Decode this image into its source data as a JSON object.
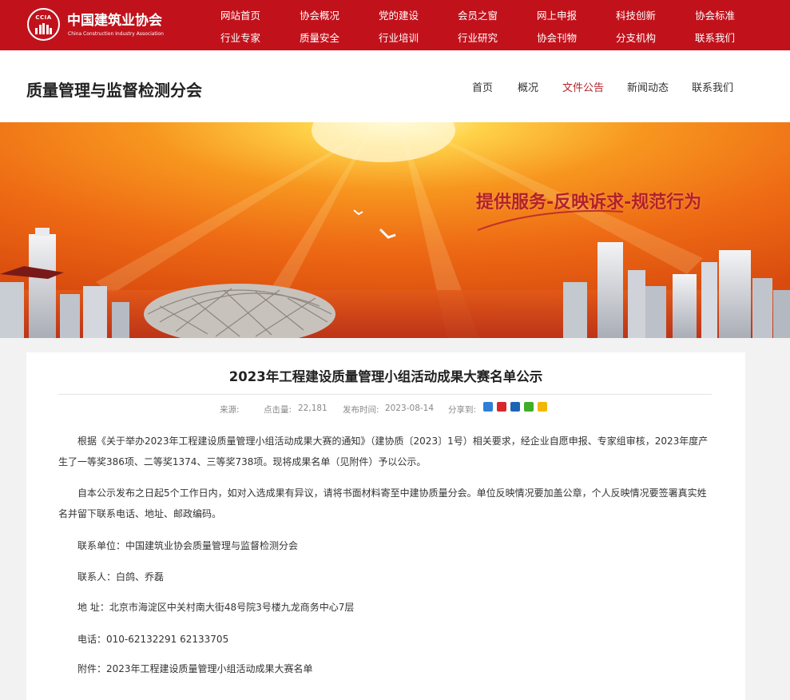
{
  "header": {
    "logo_abbr": "CCIA",
    "logo_cn": "中国建筑业协会",
    "logo_en": "China Construction Industry Association",
    "nav_row1": [
      "网站首页",
      "协会概况",
      "党的建设",
      "会员之窗",
      "网上申报",
      "科技创新",
      "协会标准"
    ],
    "nav_row2": [
      "行业专家",
      "质量安全",
      "行业培训",
      "行业研究",
      "协会刊物",
      "分支机构",
      "联系我们"
    ]
  },
  "subheader": {
    "title": "质量管理与监督检测分会",
    "nav": [
      "首页",
      "概况",
      "文件公告",
      "新闻动态",
      "联系我们"
    ],
    "active_index": 2
  },
  "banner": {
    "slogan": "提供服务-反映诉求-规范行为"
  },
  "article": {
    "title": "2023年工程建设质量管理小组活动成果大赛名单公示",
    "meta": {
      "source_label": "来源:",
      "clicks_label": "点击量:",
      "clicks": "22,181",
      "date_label": "发布时间:",
      "date": "2023-08-14",
      "share_label": "分享到:"
    },
    "share_icons": [
      "plus-share-icon",
      "weibo-share-icon",
      "renren-share-icon",
      "wechat-share-icon",
      "qzone-share-icon"
    ],
    "paragraphs": [
      "根据《关于举办2023年工程建设质量管理小组活动成果大赛的通知》（建协质〔2023〕1号）相关要求，经企业自愿申报、专家组审核，2023年度产生了一等奖386项、二等奖1374、三等奖738项。现将成果名单（见附件）予以公示。",
      "自本公示发布之日起5个工作日内，如对入选成果有异议，请将书面材料寄至中建协质量分会。单位反映情况要加盖公章，个人反映情况要签署真实姓名并留下联系电话、地址、邮政编码。"
    ],
    "contact_unit": "联系单位：中国建筑业协会质量管理与监督检测分会",
    "contact_person": "联系人：白鸽、乔磊",
    "address": "地  址：北京市海淀区中关村南大街48号院3号楼九龙商务中心7层",
    "phone": "电话：010-62132291 62133705",
    "attachment": "附件：2023年工程建设质量管理小组活动成果大赛名单"
  },
  "colors": {
    "brand_red": "#c1121c",
    "active_nav": "#b5242c",
    "banner_orange": "#f27a1a"
  }
}
